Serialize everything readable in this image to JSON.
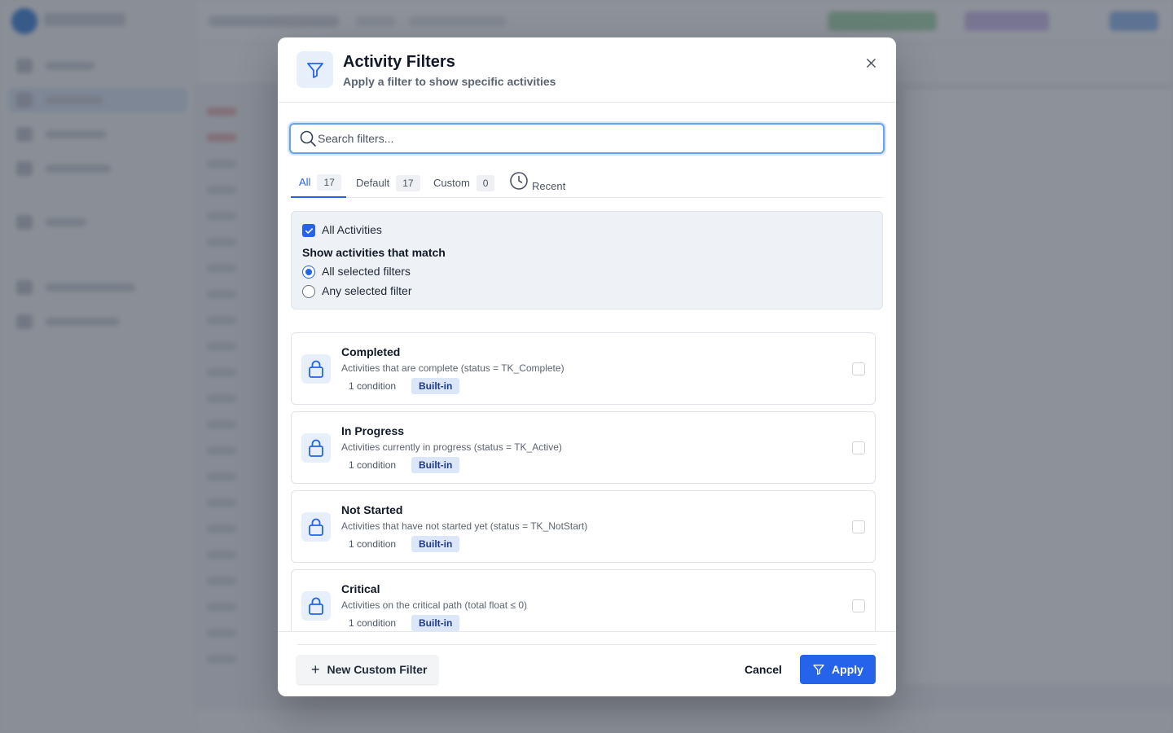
{
  "modal": {
    "title": "Activity Filters",
    "subtitle": "Apply a filter to show specific activities",
    "close_icon": "close-icon",
    "header_icon": "filter-icon"
  },
  "search": {
    "placeholder": "Search filters...",
    "value": ""
  },
  "tabs": [
    {
      "label": "All",
      "count": "17",
      "active": true
    },
    {
      "label": "Default",
      "count": "17",
      "active": false
    },
    {
      "label": "Custom",
      "count": "0",
      "active": false
    },
    {
      "label": "Recent",
      "icon": "clock-icon",
      "active": false
    }
  ],
  "match": {
    "all_activities_label": "All Activities",
    "all_activities_checked": true,
    "heading": "Show activities that match",
    "options": [
      {
        "label": "All selected filters",
        "selected": true
      },
      {
        "label": "Any selected filter",
        "selected": false
      }
    ]
  },
  "filters": [
    {
      "name": "Completed",
      "description": "Activities that are complete (status = TK_Complete)",
      "conditions": "1 condition",
      "badge": "Built-in",
      "checked": false,
      "icon": "lock-icon"
    },
    {
      "name": "In Progress",
      "description": "Activities currently in progress (status = TK_Active)",
      "conditions": "1 condition",
      "badge": "Built-in",
      "checked": false,
      "icon": "lock-icon"
    },
    {
      "name": "Not Started",
      "description": "Activities that have not started yet (status = TK_NotStart)",
      "conditions": "1 condition",
      "badge": "Built-in",
      "checked": false,
      "icon": "lock-icon"
    },
    {
      "name": "Critical",
      "description": "Activities on the critical path (total float ≤ 0)",
      "conditions": "1 condition",
      "badge": "Built-in",
      "checked": false,
      "icon": "lock-icon"
    }
  ],
  "footer": {
    "new_filter_label": "New Custom Filter",
    "cancel_label": "Cancel",
    "apply_label": "Apply"
  },
  "colors": {
    "accent": "#2563eb",
    "overlay": "#474d5a"
  }
}
